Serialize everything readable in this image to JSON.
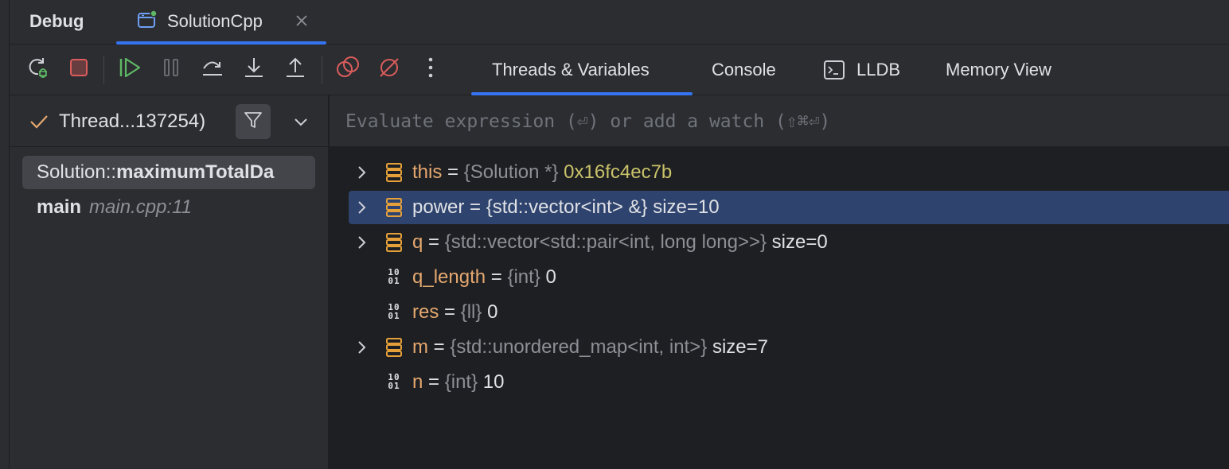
{
  "header": {
    "title": "Debug",
    "tab": {
      "label": "SolutionCpp",
      "status_color": "#5fb865"
    }
  },
  "toolbar": {
    "buttons": [
      {
        "name": "rerun-debug-button",
        "icon": "rerun-debug-icon"
      },
      {
        "name": "stop-button",
        "icon": "stop-icon",
        "color": "#db5c5c"
      },
      {
        "name": "resume-button",
        "icon": "resume-icon",
        "color": "#5fb865"
      },
      {
        "name": "pause-button",
        "icon": "pause-icon"
      },
      {
        "name": "step-over-button",
        "icon": "step-over-icon"
      },
      {
        "name": "step-into-button",
        "icon": "step-into-icon"
      },
      {
        "name": "step-out-button",
        "icon": "step-out-icon"
      },
      {
        "name": "view-breakpoints-button",
        "icon": "view-breakpoints-icon",
        "color": "#db5c5c"
      },
      {
        "name": "mute-breakpoints-button",
        "icon": "mute-breakpoints-icon",
        "color": "#db5c5c"
      },
      {
        "name": "more-options-button",
        "icon": "more-vertical-icon"
      }
    ],
    "tabs": [
      {
        "label": "Threads & Variables",
        "active": true
      },
      {
        "label": "Console",
        "active": false
      },
      {
        "label": "LLDB",
        "active": false,
        "icon": "terminal-icon"
      },
      {
        "label": "Memory View",
        "active": false
      }
    ]
  },
  "frames": {
    "thread_label": "Thread...137254)",
    "items": [
      {
        "prefix": "Solution::",
        "name": "maximumTotalDa",
        "location": "",
        "selected": true
      },
      {
        "prefix": "",
        "name": "main",
        "location": "main.cpp:11",
        "selected": false
      }
    ]
  },
  "evaluate": {
    "placeholder": "Evaluate expression (⏎) or add a watch (⇧⌘⏎)"
  },
  "variables": [
    {
      "name": "this",
      "type": "{Solution *}",
      "value": "0x16fc4ec7b",
      "kind": "struct",
      "expandable": true,
      "selected": false,
      "hex": true
    },
    {
      "name": "power",
      "type": "{std::vector<int> &}",
      "value": "size=10",
      "kind": "struct",
      "expandable": true,
      "selected": true,
      "hex": false
    },
    {
      "name": "q",
      "type": "{std::vector<std::pair<int, long long>>}",
      "value": "size=0",
      "kind": "struct",
      "expandable": true,
      "selected": false,
      "hex": false
    },
    {
      "name": "q_length",
      "type": "{int}",
      "value": "0",
      "kind": "primitive",
      "expandable": false,
      "selected": false,
      "hex": false
    },
    {
      "name": "res",
      "type": "{ll}",
      "value": "0",
      "kind": "primitive",
      "expandable": false,
      "selected": false,
      "hex": false
    },
    {
      "name": "m",
      "type": "{std::unordered_map<int, int>}",
      "value": "size=7",
      "kind": "struct",
      "expandable": true,
      "selected": false,
      "hex": false
    },
    {
      "name": "n",
      "type": "{int}",
      "value": "10",
      "kind": "primitive",
      "expandable": false,
      "selected": false,
      "hex": false
    }
  ]
}
